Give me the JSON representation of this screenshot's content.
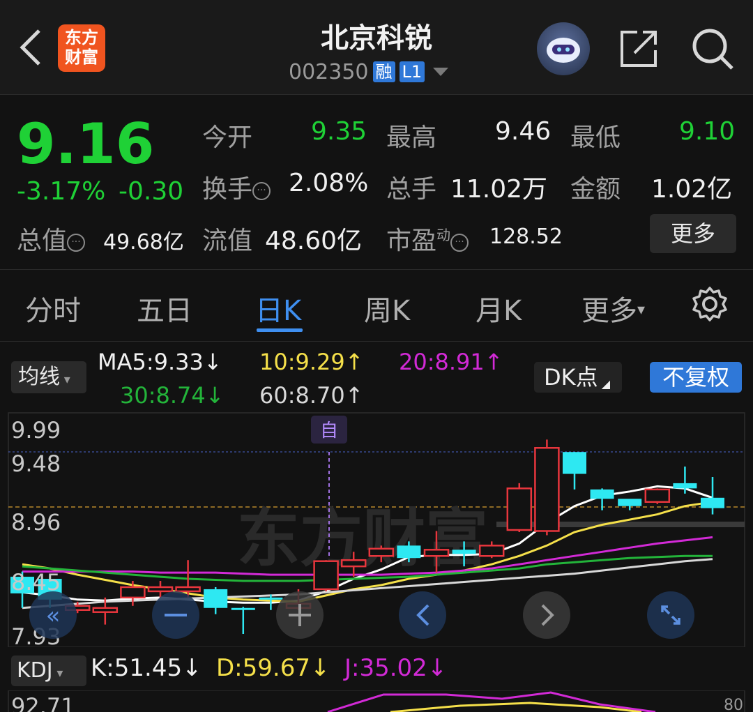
{
  "header": {
    "title": "北京科锐",
    "code": "002350",
    "badge_rong": "融",
    "badge_level": "L1",
    "logo_line1": "东方",
    "logo_line2": "财富"
  },
  "quote": {
    "price": "9.16",
    "change_pct": "-3.17%",
    "change_abs": "-0.30",
    "open_label": "今开",
    "open": "9.35",
    "high_label": "最高",
    "high": "9.46",
    "low_label": "最低",
    "low": "9.10",
    "turnover_label": "换手",
    "turnover": "2.08%",
    "volume_label": "总手",
    "volume": "11.02万",
    "amount_label": "金额",
    "amount": "1.02亿",
    "mktcap_label": "总值",
    "mktcap": "49.68亿",
    "float_label": "流值",
    "float_cap": "48.60亿",
    "pe_label": "市盈",
    "pe_sup": "动",
    "pe": "128.52",
    "more": "更多"
  },
  "tabs": [
    "分时",
    "五日",
    "日K",
    "周K",
    "月K",
    "更多"
  ],
  "active_tab": "日K",
  "ma": {
    "selector": "均线",
    "ma5": "MA5:9.33↓",
    "ma10": "10:9.29↑",
    "ma20": "20:8.91↑",
    "ma30": "30:8.74↓",
    "ma60": "60:8.70↑",
    "dk": "DK点",
    "fuquan": "不复权"
  },
  "chart_labels": {
    "y_ticks": [
      "9.99",
      "9.48",
      "8.96",
      "8.45",
      "7.93"
    ],
    "marker": "自",
    "watermark": "东方财富"
  },
  "kdj": {
    "selector": "KDJ",
    "k": "K:51.45↓",
    "d": "D:59.67↓",
    "j": "J:35.02↓",
    "partial_left": "92.71",
    "partial_right": "80"
  },
  "chart_data": {
    "type": "candlestick",
    "ylim": [
      7.93,
      9.99
    ],
    "candles": [
      {
        "o": 8.5,
        "c": 8.34,
        "h": 8.55,
        "l": 8.2
      },
      {
        "o": 8.48,
        "c": 8.28,
        "h": 8.52,
        "l": 8.2
      },
      {
        "o": 8.18,
        "c": 8.22,
        "h": 8.26,
        "l": 8.15
      },
      {
        "o": 8.16,
        "c": 8.2,
        "h": 8.3,
        "l": 8.04
      },
      {
        "o": 8.3,
        "c": 8.4,
        "h": 8.46,
        "l": 8.22
      },
      {
        "o": 8.36,
        "c": 8.4,
        "h": 8.46,
        "l": 8.3
      },
      {
        "o": 8.36,
        "c": 8.4,
        "h": 8.66,
        "l": 8.3
      },
      {
        "o": 8.38,
        "c": 8.2,
        "h": 8.4,
        "l": 8.14
      },
      {
        "o": 8.2,
        "c": 8.18,
        "h": 8.21,
        "l": 7.95
      },
      {
        "o": 8.3,
        "c": 8.28,
        "h": 8.33,
        "l": 8.18
      },
      {
        "o": 8.2,
        "c": 8.24,
        "h": 8.38,
        "l": 8.18
      },
      {
        "o": 8.38,
        "c": 8.65,
        "h": 8.66,
        "l": 8.36
      },
      {
        "o": 8.6,
        "c": 8.66,
        "h": 8.74,
        "l": 8.5
      },
      {
        "o": 8.7,
        "c": 8.77,
        "h": 8.8,
        "l": 8.64
      },
      {
        "o": 8.8,
        "c": 8.68,
        "h": 8.84,
        "l": 8.64
      },
      {
        "o": 8.7,
        "c": 8.76,
        "h": 8.94,
        "l": 8.54
      },
      {
        "o": 8.76,
        "c": 8.72,
        "h": 8.84,
        "l": 8.6
      },
      {
        "o": 8.7,
        "c": 8.8,
        "h": 8.84,
        "l": 8.68
      },
      {
        "o": 8.95,
        "c": 9.35,
        "h": 9.4,
        "l": 8.93
      },
      {
        "o": 8.94,
        "c": 9.74,
        "h": 9.82,
        "l": 8.9
      },
      {
        "o": 9.7,
        "c": 9.49,
        "h": 9.7,
        "l": 9.34
      },
      {
        "o": 9.34,
        "c": 9.25,
        "h": 9.35,
        "l": 9.14
      },
      {
        "o": 9.25,
        "c": 9.18,
        "h": 9.24,
        "l": 9.14
      },
      {
        "o": 9.22,
        "c": 9.34,
        "h": 9.35,
        "l": 9.2
      },
      {
        "o": 9.4,
        "c": 9.35,
        "h": 9.56,
        "l": 9.3
      },
      {
        "o": 9.26,
        "c": 9.16,
        "h": 9.46,
        "l": 9.1
      }
    ],
    "series": [
      {
        "name": "MA5",
        "color": "#ffffff",
        "values": [
          8.35,
          8.32,
          8.28,
          8.27,
          8.29,
          8.3,
          8.28,
          8.26,
          8.25,
          8.25,
          8.27,
          8.36,
          8.48,
          8.57,
          8.69,
          8.71,
          8.71,
          8.72,
          8.82,
          9.02,
          9.18,
          9.28,
          9.32,
          9.37,
          9.35,
          9.26
        ]
      },
      {
        "name": "10",
        "color": "#f5e04a",
        "values": [
          8.62,
          8.58,
          8.52,
          8.47,
          8.42,
          8.38,
          8.34,
          8.3,
          8.28,
          8.27,
          8.26,
          8.32,
          8.38,
          8.42,
          8.48,
          8.52,
          8.56,
          8.62,
          8.7,
          8.8,
          8.93,
          9.0,
          9.05,
          9.1,
          9.18,
          9.22
        ]
      },
      {
        "name": "20",
        "color": "#d22ad6",
        "values": [
          8.55,
          8.55,
          8.55,
          8.55,
          8.55,
          8.54,
          8.54,
          8.54,
          8.53,
          8.52,
          8.52,
          8.52,
          8.52,
          8.52,
          8.53,
          8.54,
          8.56,
          8.58,
          8.62,
          8.66,
          8.7,
          8.74,
          8.78,
          8.82,
          8.85,
          8.88
        ]
      },
      {
        "name": "30",
        "color": "#23b43a",
        "values": [
          8.6,
          8.58,
          8.56,
          8.54,
          8.52,
          8.5,
          8.48,
          8.47,
          8.46,
          8.46,
          8.46,
          8.47,
          8.48,
          8.49,
          8.5,
          8.52,
          8.54,
          8.56,
          8.58,
          8.62,
          8.64,
          8.66,
          8.68,
          8.69,
          8.7,
          8.7
        ]
      },
      {
        "name": "60",
        "color": "#d8d8d8",
        "values": [
          8.2,
          8.22,
          8.24,
          8.26,
          8.27,
          8.28,
          8.29,
          8.3,
          8.31,
          8.32,
          8.33,
          8.35,
          8.37,
          8.39,
          8.41,
          8.43,
          8.45,
          8.47,
          8.49,
          8.51,
          8.53,
          8.56,
          8.59,
          8.62,
          8.65,
          8.67
        ]
      }
    ]
  }
}
